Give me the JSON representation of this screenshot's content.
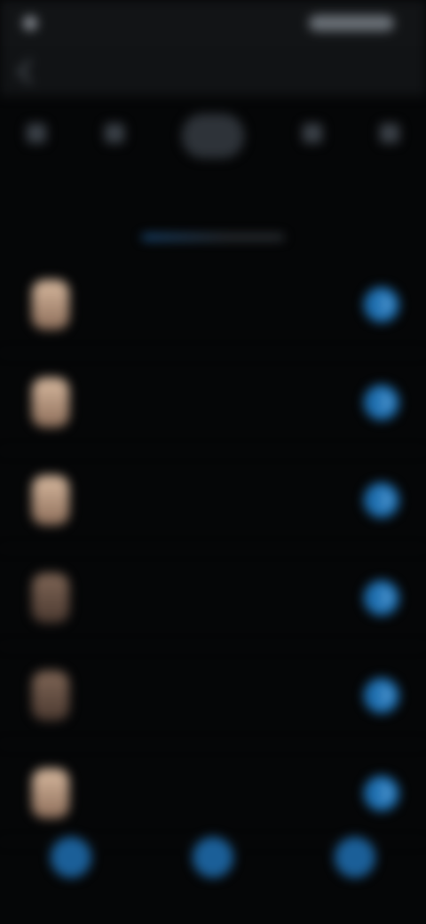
{
  "status": {
    "time": "",
    "right": ""
  },
  "header": {
    "title": ""
  },
  "nav": {
    "items": [
      "",
      "",
      "",
      ""
    ]
  },
  "tabs": [
    "",
    "",
    "",
    ""
  ],
  "list": {
    "rows": [
      {
        "title": "",
        "meta": [
          "",
          ""
        ],
        "sub": ""
      },
      {
        "title": "",
        "meta": [
          "",
          ""
        ],
        "sub": ""
      },
      {
        "title": "",
        "meta": [
          "",
          ""
        ],
        "sub": ""
      },
      {
        "title": "",
        "meta": [
          "",
          ""
        ],
        "sub": ""
      },
      {
        "title": "",
        "meta": [
          "",
          ""
        ],
        "sub": ""
      },
      {
        "title": "",
        "meta": [
          "",
          ""
        ],
        "sub": ""
      }
    ]
  },
  "colors": {
    "accent": "#1e6fb0",
    "warning": "#8a6a1e",
    "background": "#050607"
  }
}
